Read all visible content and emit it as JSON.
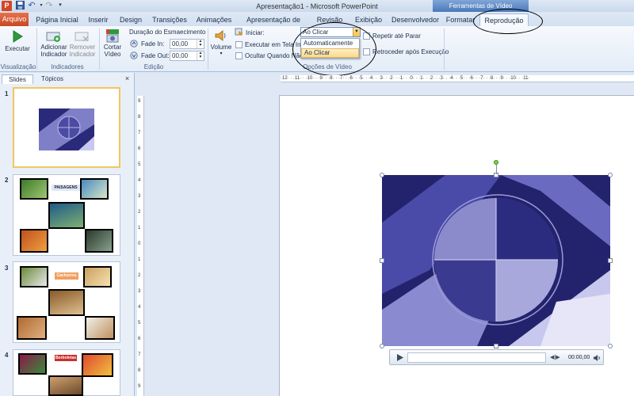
{
  "window": {
    "title": "Apresentação1 - Microsoft PowerPoint",
    "app_logo": "P"
  },
  "quick_access": {
    "save_icon": "save-icon",
    "undo_icon": "undo-icon",
    "redo_icon": "redo-icon",
    "customize_icon": "customize-icon"
  },
  "contextual": {
    "label": "Ferramentas de Vídeo"
  },
  "tabs": [
    "Arquivo",
    "Página Inicial",
    "Inserir",
    "Design",
    "Transições",
    "Animações",
    "Apresentação de Slides",
    "Revisão",
    "Exibição",
    "Desenvolvedor",
    "Formatar",
    "Reprodução"
  ],
  "ribbon": {
    "play_label": "Executar",
    "group_visualizacao": "Visualização",
    "add_bookmark": [
      "Adicionar",
      "Indicador"
    ],
    "remove_bookmark": [
      "Remover",
      "Indicador"
    ],
    "group_indicadores": "Indicadores",
    "trim_video": [
      "Cortar",
      "Vídeo"
    ],
    "fade_title": "Duração do Esmaecimento",
    "fade_in_label": "Fade In:",
    "fade_in_value": "00,00",
    "fade_out_label": "Fade Out:",
    "fade_out_value": "00,00",
    "group_edicao": "Edição",
    "volume_label": "Volume",
    "start_label": "Iniciar:",
    "start_value": "Ao Clicar",
    "start_options": [
      "Automaticamente",
      "Ao Clicar"
    ],
    "fullscreen_label": "Executar em Tela Inte",
    "hide_label": "Ocultar Quando Não",
    "loop_label": "Repetir até Parar",
    "rewind_label": "Retroceder após Execução",
    "group_opcoes": "Opções de Vídeo"
  },
  "panel": {
    "tab_slides": "Slides",
    "tab_topics": "Tópicos",
    "close": "×"
  },
  "slides": [
    {
      "number": "1"
    },
    {
      "number": "2",
      "caption": "PAISAGENS"
    },
    {
      "number": "3",
      "caption": "Cachorros"
    },
    {
      "number": "4",
      "caption": "Borboletas"
    }
  ],
  "ruler": {
    "marks": "·12· · ·11· · ·10· · ·9· · ·8· · ·7· · ·6· · ·5· · ·4· · ·3· · ·2· · ·1· · ·0· · ·1· · ·2· · ·3· · ·4· · ·5· · ·6· · ·7· · ·8· · ·9· · ·10· · ·11·",
    "vertical": [
      "9",
      "8",
      "7",
      "6",
      "5",
      "4",
      "3",
      "2",
      "1",
      "0",
      "1",
      "2",
      "3",
      "4",
      "5",
      "6",
      "7",
      "8",
      "9"
    ]
  },
  "player": {
    "time": "00:00,00",
    "progress": 0
  },
  "colors": {
    "file_tab": "#d24726",
    "accent": "#6a96d0",
    "video_base": "#23236d"
  }
}
